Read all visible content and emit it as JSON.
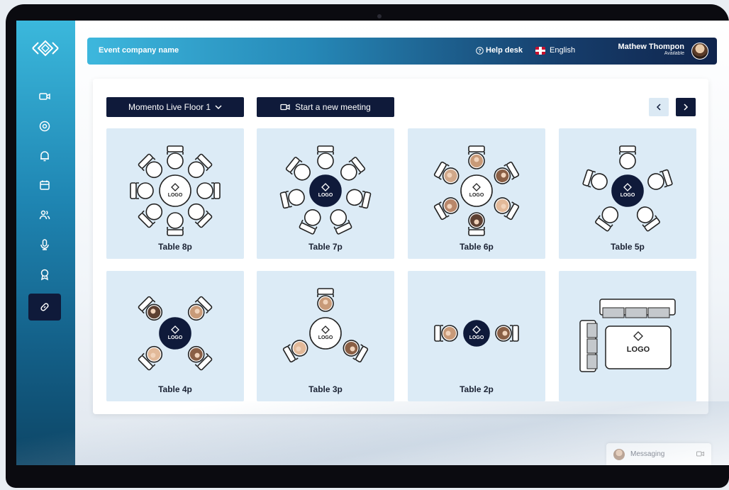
{
  "topbar": {
    "company": "Event company name",
    "help": "Help desk",
    "language": "English",
    "user_name": "Mathew Thompon",
    "user_status": "Available"
  },
  "toolbar": {
    "floor": "Momento Live Floor 1",
    "new_meeting": "Start a new meeting"
  },
  "logo_text": "LOGO",
  "tables": [
    {
      "label": "Table 8p",
      "seats": 8
    },
    {
      "label": "Table 7p",
      "seats": 7
    },
    {
      "label": "Table 6p",
      "seats": 6
    },
    {
      "label": "Table 5p",
      "seats": 5
    },
    {
      "label": "Table 4p",
      "seats": 4
    },
    {
      "label": "Table 3p",
      "seats": 3
    },
    {
      "label": "Table 2p",
      "seats": 2
    },
    {
      "label": "",
      "seats": 0
    }
  ],
  "messaging": {
    "label": "Messaging"
  },
  "colors": {
    "navy": "#0f1a3a",
    "card_bg": "#dcebf6",
    "accent": "#2a9fd0"
  }
}
